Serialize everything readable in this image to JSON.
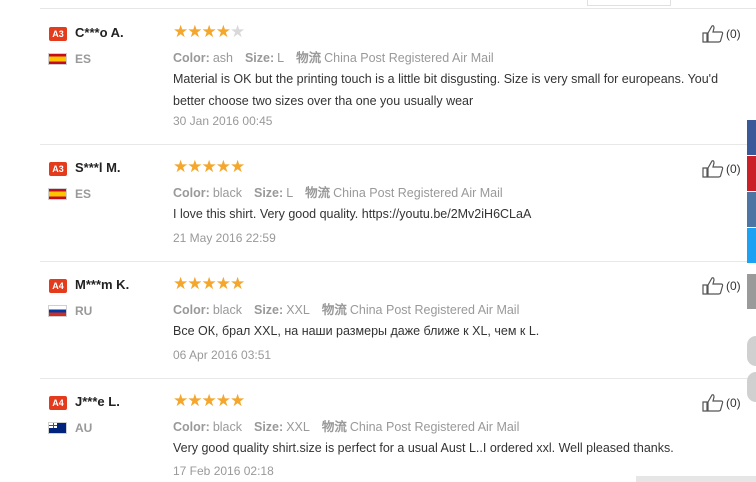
{
  "helpful_label": "(0)",
  "reviews": [
    {
      "badge": "A3",
      "name": "C***o A.",
      "country": "ES",
      "rating": 4,
      "color_label": "Color:",
      "color": "ash",
      "size_label": "Size:",
      "size": "L",
      "shipping_label": "物流",
      "shipping": "China Post Registered Air Mail",
      "text": "Material is OK but the printing touch is a little bit disgusting. Size is very small for europeans. You'd better choose two sizes over tha one you usually wear",
      "date": "30 Jan 2016 00:45"
    },
    {
      "badge": "A3",
      "name": "S***l M.",
      "country": "ES",
      "rating": 5,
      "color_label": "Color:",
      "color": "black",
      "size_label": "Size:",
      "size": "L",
      "shipping_label": "物流",
      "shipping": "China Post Registered Air Mail",
      "text": "I love this shirt. Very good quality. https://youtu.be/2Mv2iH6CLaA",
      "date": "21 May 2016 22:59"
    },
    {
      "badge": "A4",
      "name": "M***m K.",
      "country": "RU",
      "rating": 5,
      "color_label": "Color:",
      "color": "black",
      "size_label": "Size:",
      "size": "XXL",
      "shipping_label": "物流",
      "shipping": "China Post Registered Air Mail",
      "text": "Все ОК, брал XXL, на наши размеры даже ближе к XL, чем к L.",
      "date": "06 Apr 2016 03:51"
    },
    {
      "badge": "A4",
      "name": "J***e L.",
      "country": "AU",
      "rating": 5,
      "color_label": "Color:",
      "color": "black",
      "size_label": "Size:",
      "size": "XXL",
      "shipping_label": "物流",
      "shipping": "China Post Registered Air Mail",
      "text": "Very good quality shirt.size is perfect for a usual Aust L..I ordered xxl. Well pleased thanks.",
      "date": "17 Feb 2016 02:18"
    }
  ],
  "colors": {
    "star": "#f4a72c",
    "star_empty": "#d9d9d9",
    "badge": "#e33b1b",
    "facebook": "#3b5998",
    "pinterest": "#cb2027",
    "vk": "#4c75a3",
    "twitter": "#1da1f2"
  }
}
